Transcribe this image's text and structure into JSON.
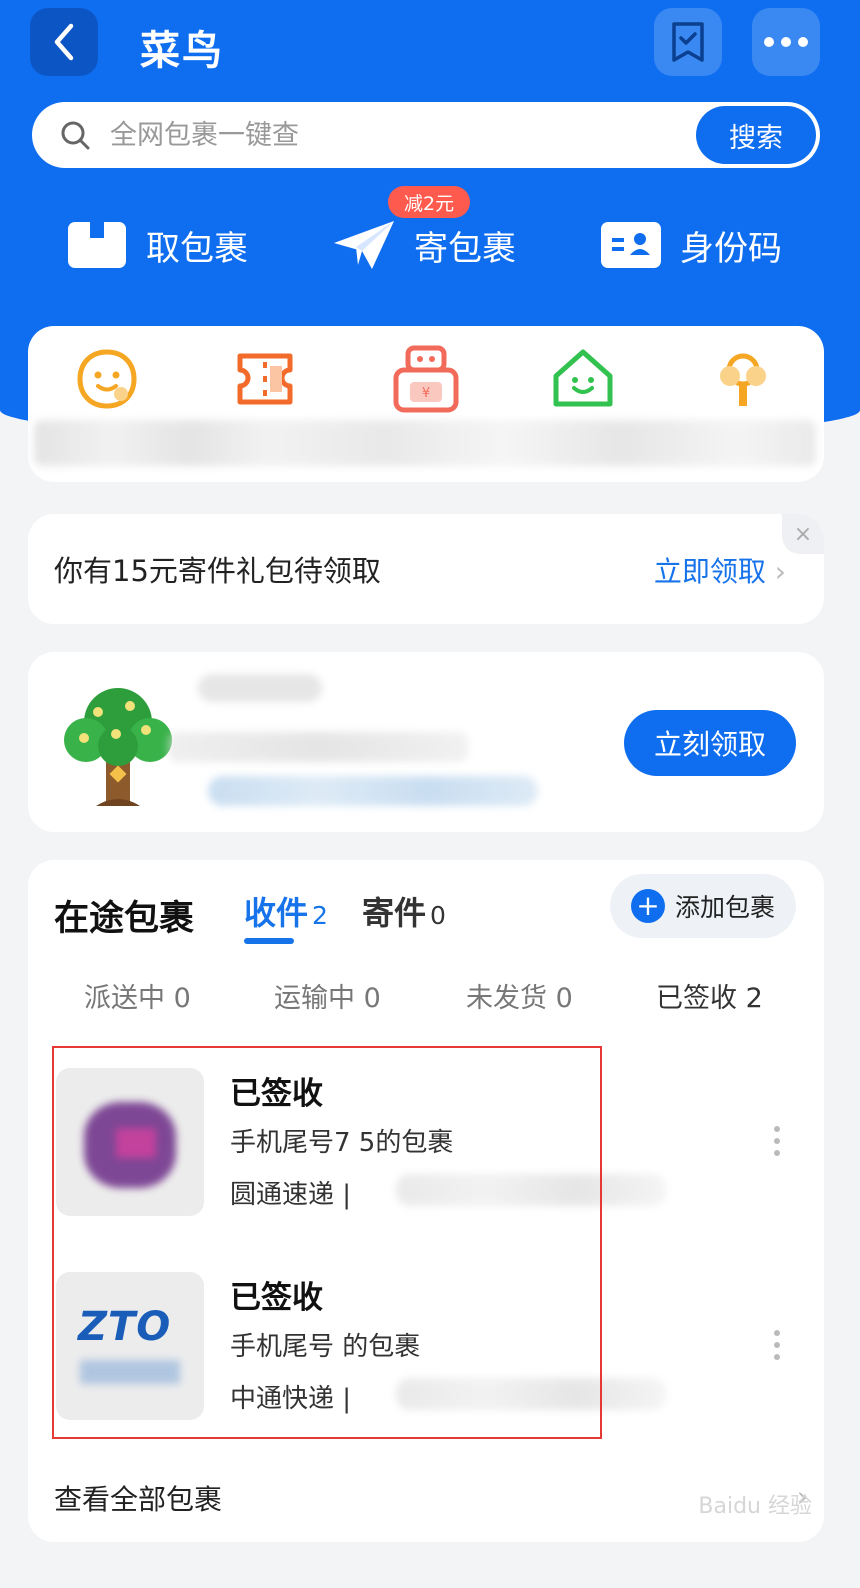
{
  "header": {
    "title": "菜鸟"
  },
  "search": {
    "placeholder": "全网包裹一键查",
    "button_label": "搜索"
  },
  "quick_actions": [
    {
      "label": "取包裹",
      "icon": "package-icon"
    },
    {
      "label": "寄包裹",
      "icon": "paper-plane-icon",
      "badge": "减2元"
    },
    {
      "label": "身份码",
      "icon": "id-card-icon"
    }
  ],
  "services": [
    {
      "icon": "smiley-icon",
      "color": "#f5a623"
    },
    {
      "icon": "ticket-icon",
      "color": "#f26b2a"
    },
    {
      "icon": "wallet-icon",
      "color": "#f26b5a"
    },
    {
      "icon": "house-icon",
      "color": "#31c24f"
    },
    {
      "icon": "tree-icon",
      "color": "#f5a623"
    }
  ],
  "promo": {
    "text": "你有15元寄件礼包待领取",
    "link": "立即领取",
    "close": "×"
  },
  "reward": {
    "button": "立刻领取"
  },
  "packages": {
    "title": "在途包裹",
    "tab_receive": "收件",
    "tab_receive_count": "2",
    "tab_send": "寄件",
    "tab_send_count": "0",
    "add_label": "添加包裹",
    "status_tabs": [
      {
        "label": "派送中 0"
      },
      {
        "label": "运输中 0"
      },
      {
        "label": "未发货 0"
      },
      {
        "label": "已签收 2"
      }
    ],
    "items": [
      {
        "status": "已签收",
        "desc": "手机尾号7 5的包裹",
        "carrier": "圆通速递 |",
        "logo": "yto-logo"
      },
      {
        "status": "已签收",
        "desc": "手机尾号 的包裹",
        "carrier": "中通快递 |",
        "logo": "zto-logo",
        "logo_text": "ZTO"
      }
    ],
    "view_all": "查看全部包裹"
  },
  "watermark": "Baidu 经验",
  "colors": {
    "brand_blue": "#0f6ef0",
    "link_blue": "#1673ea",
    "badge_red": "#ff5a4e",
    "highlight_red": "#e53935"
  }
}
